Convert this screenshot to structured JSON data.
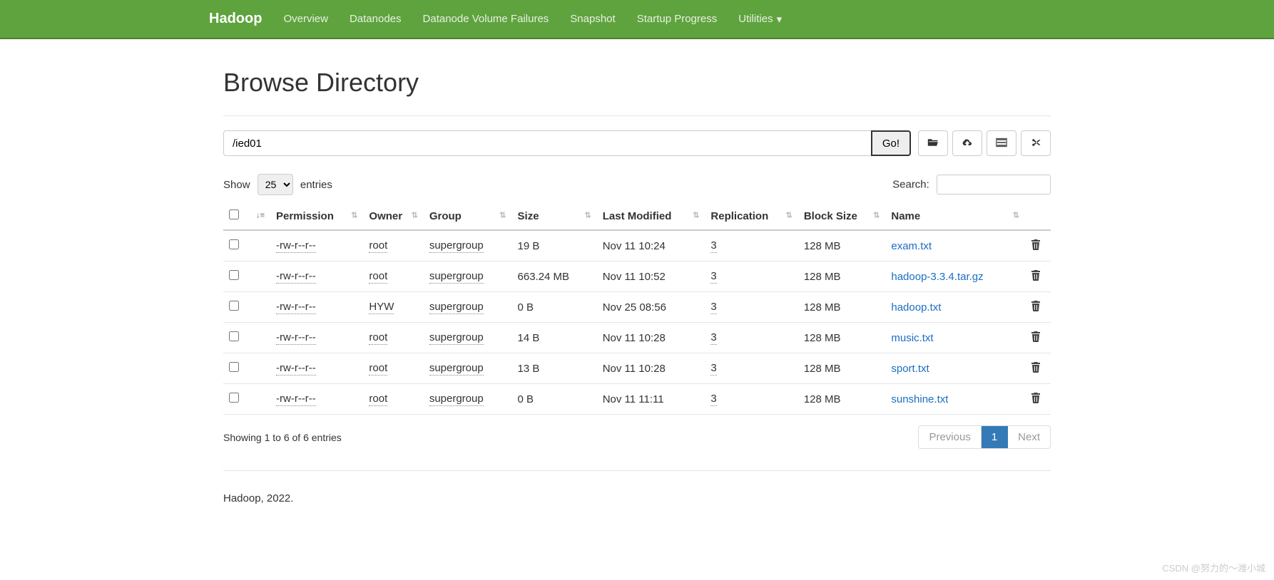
{
  "nav": {
    "brand": "Hadoop",
    "items": [
      "Overview",
      "Datanodes",
      "Datanode Volume Failures",
      "Snapshot",
      "Startup Progress",
      "Utilities"
    ]
  },
  "page": {
    "title": "Browse Directory"
  },
  "path": {
    "value": "/ied01",
    "go": "Go!"
  },
  "lengthMenu": {
    "show": "Show",
    "entries": "entries",
    "value": "25"
  },
  "search": {
    "label": "Search:"
  },
  "columns": [
    "Permission",
    "Owner",
    "Group",
    "Size",
    "Last Modified",
    "Replication",
    "Block Size",
    "Name"
  ],
  "rows": [
    {
      "perm": "-rw-r--r--",
      "owner": "root",
      "group": "supergroup",
      "size": "19 B",
      "modified": "Nov 11 10:24",
      "repl": "3",
      "block": "128 MB",
      "name": "exam.txt"
    },
    {
      "perm": "-rw-r--r--",
      "owner": "root",
      "group": "supergroup",
      "size": "663.24 MB",
      "modified": "Nov 11 10:52",
      "repl": "3",
      "block": "128 MB",
      "name": "hadoop-3.3.4.tar.gz"
    },
    {
      "perm": "-rw-r--r--",
      "owner": "HYW",
      "group": "supergroup",
      "size": "0 B",
      "modified": "Nov 25 08:56",
      "repl": "3",
      "block": "128 MB",
      "name": "hadoop.txt"
    },
    {
      "perm": "-rw-r--r--",
      "owner": "root",
      "group": "supergroup",
      "size": "14 B",
      "modified": "Nov 11 10:28",
      "repl": "3",
      "block": "128 MB",
      "name": "music.txt"
    },
    {
      "perm": "-rw-r--r--",
      "owner": "root",
      "group": "supergroup",
      "size": "13 B",
      "modified": "Nov 11 10:28",
      "repl": "3",
      "block": "128 MB",
      "name": "sport.txt"
    },
    {
      "perm": "-rw-r--r--",
      "owner": "root",
      "group": "supergroup",
      "size": "0 B",
      "modified": "Nov 11 11:11",
      "repl": "3",
      "block": "128 MB",
      "name": "sunshine.txt"
    }
  ],
  "info": "Showing 1 to 6 of 6 entries",
  "pagination": {
    "prev": "Previous",
    "page": "1",
    "next": "Next"
  },
  "footer": "Hadoop, 2022.",
  "watermark": "CSDN @努力的～潍小城"
}
